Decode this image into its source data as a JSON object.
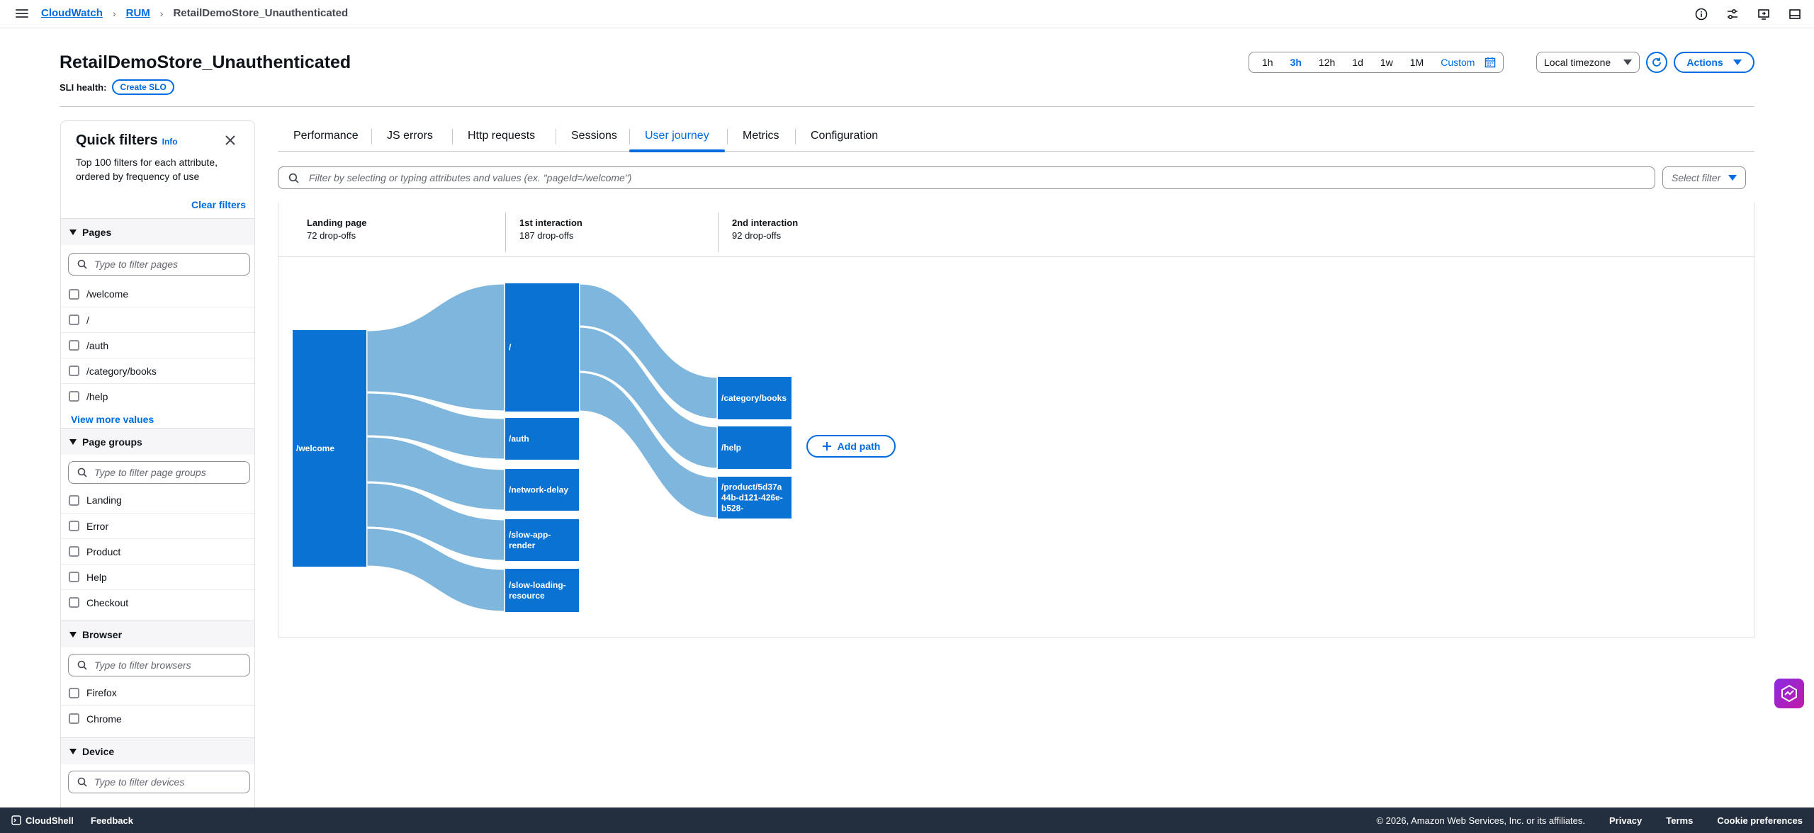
{
  "breadcrumb": {
    "items": [
      "CloudWatch",
      "RUM"
    ],
    "current": "RetailDemoStore_Unauthenticated"
  },
  "header": {
    "title": "RetailDemoStore_Unauthenticated",
    "sli_label": "SLI health:",
    "create_slo": "Create SLO",
    "time_options": [
      "1h",
      "3h",
      "12h",
      "1d",
      "1w",
      "1M"
    ],
    "active_time": "3h",
    "custom_label": "Custom",
    "timezone": "Local timezone",
    "actions_label": "Actions"
  },
  "quick_filters": {
    "title": "Quick filters",
    "info": "Info",
    "description": "Top 100 filters for each attribute, ordered by frequency of use",
    "clear_label": "Clear filters",
    "view_more": "View more values",
    "sections": {
      "pages": {
        "title": "Pages",
        "placeholder": "Type to filter pages",
        "options": [
          "/welcome",
          "/",
          "/auth",
          "/category/books",
          "/help"
        ]
      },
      "page_groups": {
        "title": "Page groups",
        "placeholder": "Type to filter page groups",
        "options": [
          "Landing",
          "Error",
          "Product",
          "Help",
          "Checkout"
        ]
      },
      "browser": {
        "title": "Browser",
        "placeholder": "Type to filter browsers",
        "options": [
          "Firefox",
          "Chrome"
        ]
      },
      "device": {
        "title": "Device",
        "placeholder": "Type to filter devices"
      }
    }
  },
  "tabs": [
    "Performance",
    "JS errors",
    "Http requests",
    "Sessions",
    "User journey",
    "Metrics",
    "Configuration"
  ],
  "active_tab": "User journey",
  "filter_bar": {
    "placeholder": "Filter by selecting or typing attributes and values (ex. \"pageId=/welcome\")",
    "select_label": "Select filter"
  },
  "journey": {
    "stages": [
      {
        "title": "Landing page",
        "dropoffs": "72 drop-offs"
      },
      {
        "title": "1st interaction",
        "dropoffs": "187 drop-offs"
      },
      {
        "title": "2nd interaction",
        "dropoffs": "92 drop-offs"
      }
    ],
    "nodes": {
      "landing": [
        "/welcome"
      ],
      "first": [
        "/",
        "/auth",
        "/network-delay",
        "/slow-app-render",
        "/slow-loading-resource"
      ],
      "first_lines": [
        [
          "/"
        ],
        [
          "/auth"
        ],
        [
          "/network-delay"
        ],
        [
          "/slow-app-",
          "render"
        ],
        [
          "/slow-loading-",
          "resource"
        ]
      ],
      "second": [
        "/category/books",
        "/help",
        "/product/5d37a44b-d121-426e-b528-"
      ],
      "second_lines": [
        [
          "/category/books"
        ],
        [
          "/help"
        ],
        [
          "/product/5d37a",
          "44b-d121-426e-",
          "b528-"
        ]
      ]
    },
    "add_path": "Add path",
    "colors": {
      "node": "#0972d3",
      "link": "#7fb6dd"
    }
  },
  "footer": {
    "cloudshell": "CloudShell",
    "feedback": "Feedback",
    "copyright": "© 2026, Amazon Web Services, Inc. or its affiliates.",
    "links": [
      "Privacy",
      "Terms",
      "Cookie preferences"
    ]
  }
}
